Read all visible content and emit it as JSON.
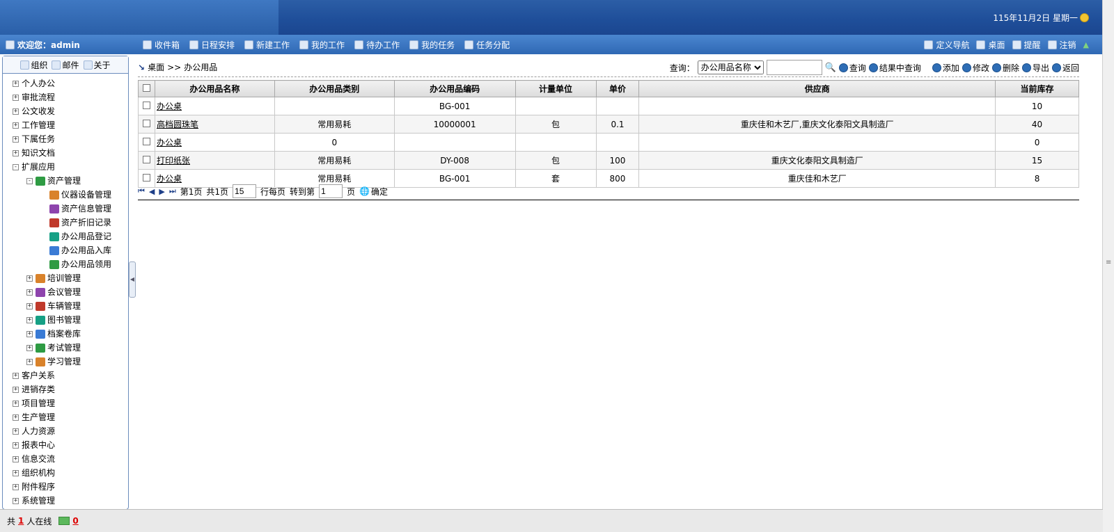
{
  "header": {
    "date": "115年11月2日 星期一"
  },
  "menubar": {
    "welcome": "欢迎您：admin",
    "nav": [
      "收件箱",
      "日程安排",
      "新建工作",
      "我的工作",
      "待办工作",
      "我的任务",
      "任务分配"
    ],
    "right_nav": [
      "定义导航",
      "桌面",
      "提醒",
      "注销"
    ]
  },
  "sidebar": {
    "tabs": [
      "组织",
      "邮件",
      "关于"
    ],
    "tree": [
      {
        "label": "个人办公",
        "level": 0,
        "state": "+"
      },
      {
        "label": "审批流程",
        "level": 0,
        "state": "+"
      },
      {
        "label": "公文收发",
        "level": 0,
        "state": "+"
      },
      {
        "label": "工作管理",
        "level": 0,
        "state": "+"
      },
      {
        "label": "下属任务",
        "level": 0,
        "state": "+"
      },
      {
        "label": "知识文档",
        "level": 0,
        "state": "+"
      },
      {
        "label": "扩展应用",
        "level": 0,
        "state": "-"
      },
      {
        "label": "资产管理",
        "level": 1,
        "state": "-"
      },
      {
        "label": "仪器设备管理",
        "level": 2,
        "state": ""
      },
      {
        "label": "资产信息管理",
        "level": 2,
        "state": ""
      },
      {
        "label": "资产折旧记录",
        "level": 2,
        "state": ""
      },
      {
        "label": "办公用品登记",
        "level": 2,
        "state": ""
      },
      {
        "label": "办公用品入库",
        "level": 2,
        "state": ""
      },
      {
        "label": "办公用品领用",
        "level": 2,
        "state": ""
      },
      {
        "label": "培训管理",
        "level": 1,
        "state": "+"
      },
      {
        "label": "会议管理",
        "level": 1,
        "state": "+"
      },
      {
        "label": "车辆管理",
        "level": 1,
        "state": "+"
      },
      {
        "label": "图书管理",
        "level": 1,
        "state": "+"
      },
      {
        "label": "档案卷库",
        "level": 1,
        "state": "+"
      },
      {
        "label": "考试管理",
        "level": 1,
        "state": "+"
      },
      {
        "label": "学习管理",
        "level": 1,
        "state": "+"
      },
      {
        "label": "客户关系",
        "level": 0,
        "state": "+"
      },
      {
        "label": "进销存类",
        "level": 0,
        "state": "+"
      },
      {
        "label": "项目管理",
        "level": 0,
        "state": "+"
      },
      {
        "label": "生产管理",
        "level": 0,
        "state": "+"
      },
      {
        "label": "人力资源",
        "level": 0,
        "state": "+"
      },
      {
        "label": "报表中心",
        "level": 0,
        "state": "+"
      },
      {
        "label": "信息交流",
        "level": 0,
        "state": "+"
      },
      {
        "label": "组织机构",
        "level": 0,
        "state": "+"
      },
      {
        "label": "附件程序",
        "level": 0,
        "state": "+"
      },
      {
        "label": "系统管理",
        "level": 0,
        "state": "+"
      }
    ]
  },
  "breadcrumb": {
    "home": "桌面",
    "sep": ">>",
    "current": "办公用品"
  },
  "toolbar": {
    "query_label": "查询：",
    "query_field": "办公用品名称",
    "query_value": "",
    "buttons": [
      "查询",
      "结果中查询",
      "添加",
      "修改",
      "删除",
      "导出",
      "返回"
    ]
  },
  "table": {
    "columns": [
      "办公用品名称",
      "办公用品类别",
      "办公用品编码",
      "计量单位",
      "单价",
      "供应商",
      "当前库存"
    ],
    "rows": [
      [
        "办公桌",
        "",
        "BG-001",
        "",
        "",
        "",
        "10"
      ],
      [
        "高档圆珠笔",
        "常用易耗",
        "10000001",
        "包",
        "0.1",
        "重庆佳和木艺厂,重庆文化泰阳文具制造厂",
        "40"
      ],
      [
        "办公桌",
        "0",
        "",
        "",
        "",
        "",
        "0"
      ],
      [
        "打印纸张",
        "常用易耗",
        "DY-008",
        "包",
        "100",
        "重庆文化泰阳文具制造厂",
        "15"
      ],
      [
        "办公桌",
        "常用易耗",
        "BG-001",
        "套",
        "800",
        "重庆佳和木艺厂",
        "8"
      ]
    ]
  },
  "pager": {
    "page_info": "第1页",
    "total_info": "共1页",
    "page_size": "15",
    "rows_label": "行每页",
    "goto_label": "转到第",
    "goto_value": "1",
    "page_suffix": "页",
    "confirm": "确定"
  },
  "footer": {
    "prefix": "共",
    "online_count": "1",
    "online_suffix": "人在线",
    "mail_count": "0"
  }
}
